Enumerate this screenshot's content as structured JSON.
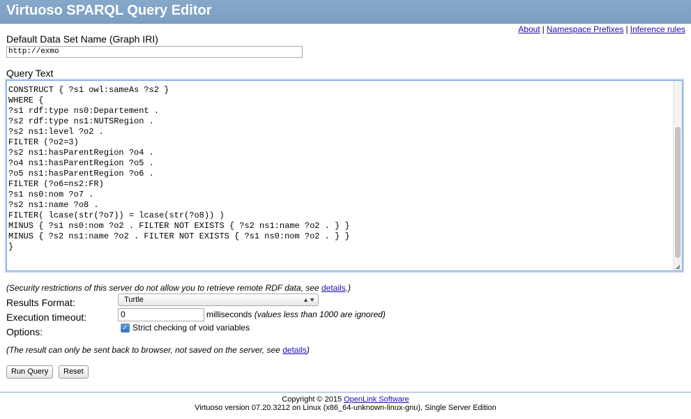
{
  "header": {
    "title": "Virtuoso SPARQL Query Editor"
  },
  "top_links": {
    "about": "About",
    "namespace": "Namespace Prefixes",
    "inference": "Inference rules",
    "separator": "|"
  },
  "graph": {
    "label": "Default Data Set Name (Graph IRI)",
    "value": "http://exmo"
  },
  "query": {
    "label": "Query Text",
    "text": "\nCONSTRUCT { ?s1 owl:sameAs ?s2 }\nWHERE {\n?s1 rdf:type ns0:Departement .\n?s2 rdf:type ns1:NUTSRegion .\n?s2 ns1:level ?o2 .\nFILTER (?o2=3)\n?s2 ns1:hasParentRegion ?o4 .\n?o4 ns1:hasParentRegion ?o5 .\n?o5 ns1:hasParentRegion ?o6 .\nFILTER (?o6=ns2:FR)\n?s1 ns0:nom ?o7 .\n?s2 ns1:name ?o8 .\nFILTER( lcase(str(?o7)) = lcase(str(?o8)) )\nMINUS { ?s1 ns0:nom ?o2 . FILTER NOT EXISTS { ?s2 ns1:name ?o2 . } }\nMINUS { ?s2 ns1:name ?o2 . FILTER NOT EXISTS { ?s1 ns0:nom ?o2 . } }\n}"
  },
  "security_note": {
    "prefix": "(Security restrictions of this server do not allow you to retrieve remote RDF data, see ",
    "link": "details",
    "suffix": ".)"
  },
  "results_format": {
    "label": "Results Format:",
    "selected": "Turtle"
  },
  "timeout": {
    "label": "Execution timeout:",
    "value": "0",
    "unit": "milliseconds",
    "note": "(values less than 1000 are ignored)"
  },
  "options": {
    "label": "Options:",
    "strict_label": "Strict checking of void variables",
    "strict_checked": true
  },
  "result_note": {
    "prefix": "(The result can only be sent back to browser, not saved on the server, see ",
    "link": "details",
    "suffix": ")"
  },
  "buttons": {
    "run": "Run Query",
    "reset": "Reset"
  },
  "footer": {
    "copyright": "Copyright © 2015 ",
    "company": "OpenLink Software",
    "version": "Virtuoso version 07.20.3212 on Linux (x86_64-unknown-linux-gnu), Single Server Edition"
  }
}
